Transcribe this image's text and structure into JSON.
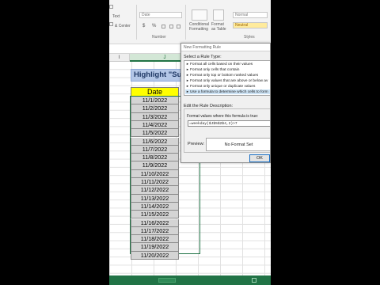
{
  "ribbon": {
    "text_label": "Text",
    "merge_label": "& Center",
    "number_format": "Date",
    "number_group": "Number",
    "cond_format_label": "Conditional Formatting",
    "format_table_label": "Format as Table",
    "style_normal": "Normal",
    "style_neutral": "Neutral",
    "styles_group": "Styles",
    "currency_symbol": "$",
    "percent_symbol": "%"
  },
  "columns": {
    "i": "I",
    "j": "J"
  },
  "sheet": {
    "title": "Highlight \"Sun",
    "header": "Date",
    "dates": [
      "11/1/2022",
      "11/2/2022",
      "11/3/2022",
      "11/4/2022",
      "11/5/2022",
      "11/6/2022",
      "11/7/2022",
      "11/8/2022",
      "11/9/2022",
      "11/10/2022",
      "11/11/2022",
      "11/12/2022",
      "11/13/2022",
      "11/14/2022",
      "11/15/2022",
      "11/16/2022",
      "11/17/2022",
      "11/18/2022",
      "11/19/2022",
      "11/20/2022"
    ]
  },
  "dialog": {
    "title": "New Formatting Rule",
    "select_rule_type": "Select a Rule Type:",
    "rule_types": [
      "Format all cells based on their values",
      "Format only cells that contain",
      "Format only top or bottom ranked values",
      "Format only values that are above or below av",
      "Format only unique or duplicate values",
      "Use a formula to determine which cells to form"
    ],
    "selected_rule_index": 5,
    "edit_rule_description": "Edit the Rule Description:",
    "formula_label": "Format values where this formula is true:",
    "formula_value": "=weekday($J$5$2$4,2)>7",
    "preview_label": "Preview:",
    "preview_text": "No Format Set",
    "ok_label": "OK"
  },
  "colors": {
    "excel_green": "#217346",
    "title_fill": "#b4c7e7",
    "header_fill": "#ffff00",
    "date_fill": "#d4d4d4"
  }
}
